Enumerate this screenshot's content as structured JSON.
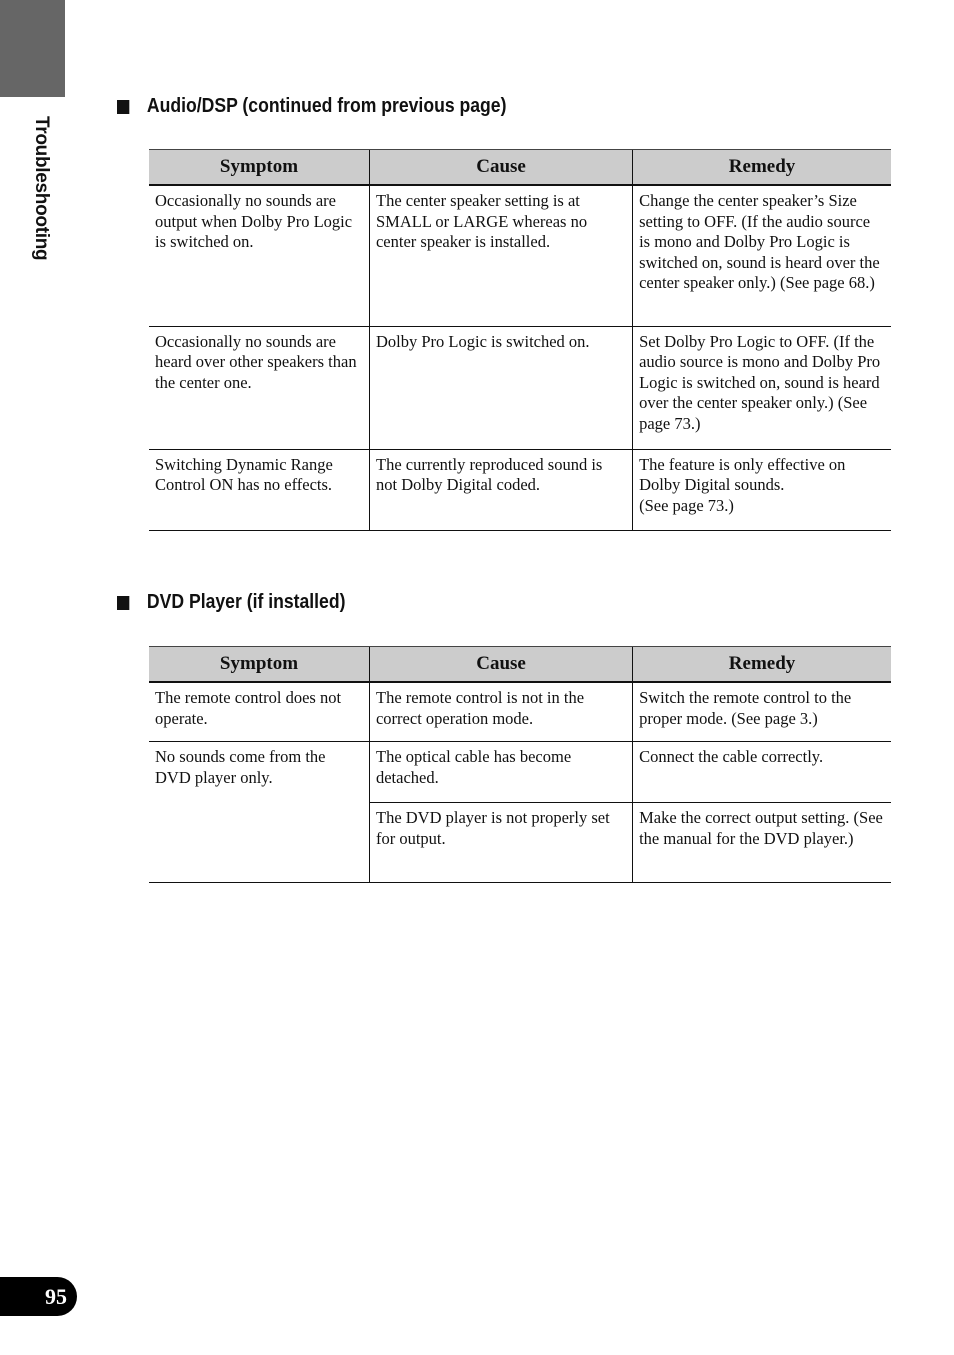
{
  "side_tab": {
    "label": "Troubleshooting"
  },
  "sections": [
    {
      "title": "Audio/DSP (continued from previous page)",
      "columns": [
        "Symptom",
        "Cause",
        "Remedy"
      ],
      "rows": [
        {
          "symptom": "Occasionally no sounds are output when Dolby Pro Logic is switched on.",
          "cause": "The center speaker setting is at SMALL or LARGE whereas no center speaker is installed.",
          "remedy": "Change the center speaker’s Size setting to OFF. (If the audio source is mono and Dolby Pro Logic is switched on, sound is heard over the center speaker only.) (See page 68.)"
        },
        {
          "symptom": "Occasionally no sounds are heard over other speakers than the center one.",
          "cause": "Dolby Pro Logic is switched on.",
          "remedy": "Set Dolby Pro Logic to OFF. (If the audio source is mono and Dolby Pro Logic is switched on, sound is heard over the center speaker only.) (See page 73.)"
        },
        {
          "symptom": "Switching Dynamic Range Control ON has no effects.",
          "cause": "The currently reproduced sound is not Dolby Digital coded.",
          "remedy_lines": [
            "The feature is only effective on Dolby Digital sounds.",
            "(See page 73.)"
          ]
        }
      ]
    },
    {
      "title": "DVD Player (if installed)",
      "columns": [
        "Symptom",
        "Cause",
        "Remedy"
      ],
      "rows": [
        {
          "symptom": "The remote control does not operate.",
          "cause": "The remote control is not in the correct operation mode.",
          "remedy": "Switch the remote control to the proper mode. (See page 3.)"
        },
        {
          "symptom": "No sounds come from the DVD player only.",
          "causes": [
            {
              "cause": "The optical cable has become detached.",
              "remedy": "Connect the cable correctly."
            },
            {
              "cause": "The DVD player is not properly set for output.",
              "remedy": "Make the correct output setting. (See the manual for the DVD player.)"
            }
          ]
        }
      ]
    }
  ],
  "page_number": "95"
}
